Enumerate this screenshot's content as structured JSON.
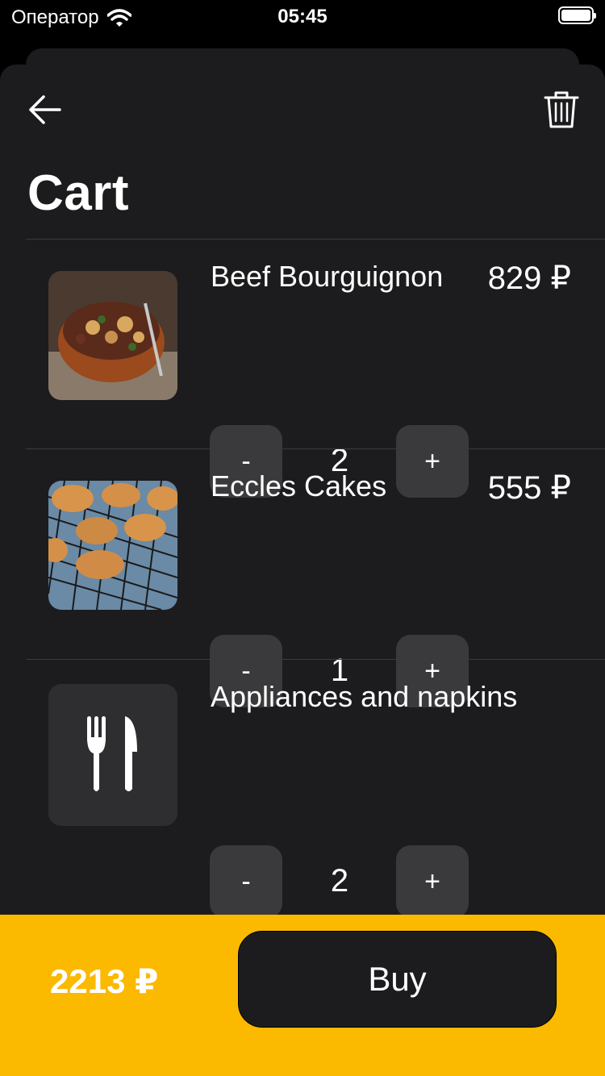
{
  "status_bar": {
    "carrier": "Оператор",
    "time": "05:45"
  },
  "page": {
    "title": "Cart"
  },
  "cart": {
    "items": [
      {
        "name": "Beef Bourguignon",
        "price": "829 ₽",
        "quantity": "2",
        "minus": "-",
        "plus": "+"
      },
      {
        "name": "Eccles Cakes",
        "price": "555 ₽",
        "quantity": "1",
        "minus": "-",
        "plus": "+"
      },
      {
        "name": "Appliances and napkins",
        "price": "",
        "quantity": "2",
        "minus": "-",
        "plus": "+"
      }
    ]
  },
  "footer": {
    "total": "2213 ₽",
    "buy_label": "Buy"
  },
  "colors": {
    "accent": "#fbb900",
    "background": "#1c1c1e",
    "button": "#3a3a3c"
  }
}
